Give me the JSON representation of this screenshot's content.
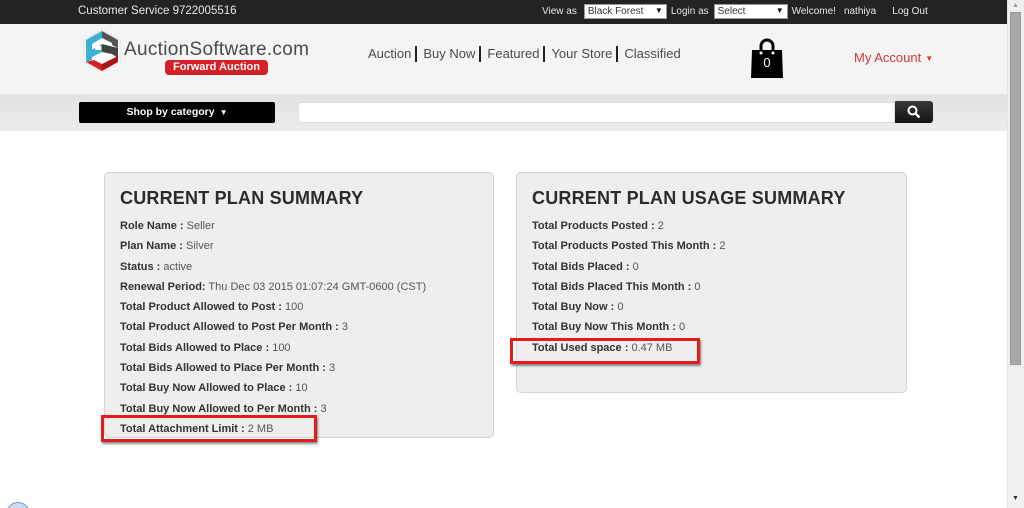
{
  "topbar": {
    "customer_service": "Customer Service 9722005516",
    "view_as_label": "View as",
    "view_as_value": "Black Forest",
    "login_as_label": "Login as",
    "login_as_value": "Select",
    "welcome": "Welcome!",
    "username": "nathiya",
    "logout": "Log Out"
  },
  "header": {
    "logo_text": "AuctionSoftware.com",
    "logo_badge": "Forward Auction",
    "nav": [
      "Auction",
      "Buy Now",
      "Featured",
      "Your Store",
      "Classified"
    ],
    "cart_count": "0",
    "account_label": "My Account"
  },
  "search_bar": {
    "category_button": "Shop by category",
    "search_value": "",
    "search_icon": "search-icon"
  },
  "plan_summary": {
    "title": "CURRENT PLAN SUMMARY",
    "rows": [
      {
        "label": "Role Name :",
        "value": " Seller"
      },
      {
        "label": "Plan Name :",
        "value": " Silver"
      },
      {
        "label": "Status :",
        "value": " active"
      },
      {
        "label": "Renewal Period:",
        "value": " Thu Dec 03 2015 01:07:24 GMT-0600 (CST)"
      },
      {
        "label": "Total Product Allowed to Post :",
        "value": " 100"
      },
      {
        "label": "Total Product Allowed to Post Per Month :",
        "value": " 3"
      },
      {
        "label": "Total Bids Allowed to Place :",
        "value": " 100"
      },
      {
        "label": "Total Bids Allowed to Place Per Month :",
        "value": " 3"
      },
      {
        "label": "Total Buy Now Allowed to Place :",
        "value": " 10"
      },
      {
        "label": "Total Buy Now Allowed to Per Month :",
        "value": " 3"
      },
      {
        "label": "Total Attachment Limit :",
        "value": " 2 MB"
      }
    ]
  },
  "usage_summary": {
    "title": "CURRENT PLAN USAGE SUMMARY",
    "rows": [
      {
        "label": "Total Products Posted :",
        "value": " 2"
      },
      {
        "label": "Total Products Posted This Month :",
        "value": " 2"
      },
      {
        "label": "Total Bids Placed :",
        "value": " 0"
      },
      {
        "label": "Total Bids Placed This Month :",
        "value": " 0"
      },
      {
        "label": "Total Buy Now :",
        "value": " 0"
      },
      {
        "label": "Total Buy Now This Month :",
        "value": " 0"
      },
      {
        "label": "Total Used space :",
        "value": " 0.47 MB"
      }
    ]
  },
  "colors": {
    "topbar_bg": "#222424",
    "brand_red": "#d42027",
    "account_red": "#d0373b",
    "highlight_red": "#e31c1c",
    "panel_bg": "#eeeeee"
  }
}
